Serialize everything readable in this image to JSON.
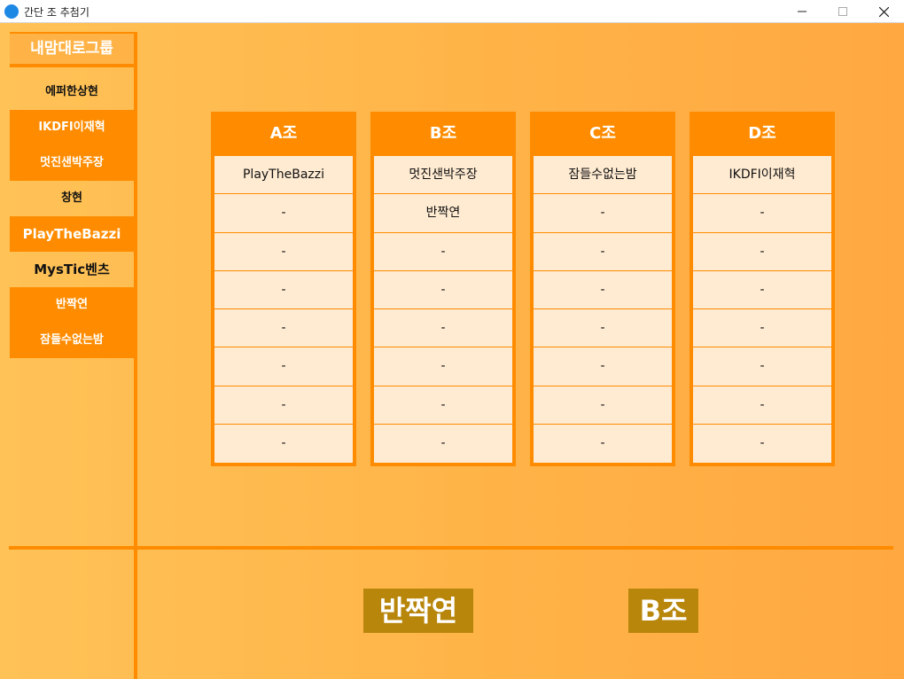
{
  "window": {
    "title": "간단 조 추첨기",
    "app_icon_text": "",
    "minimize_glyph": "—",
    "maximize_glyph": "☐",
    "close_glyph": "✕"
  },
  "sidebar": {
    "group_title": "내맘대로그룹",
    "members": [
      {
        "label": "에퍼한상현",
        "highlighted": false
      },
      {
        "label": "IKDFI이재혁",
        "highlighted": true
      },
      {
        "label": "멋진샌박주장",
        "highlighted": true
      },
      {
        "label": "창현",
        "highlighted": false
      },
      {
        "label": "PlayTheBazzi",
        "highlighted": true
      },
      {
        "label": "MysTic벤츠",
        "highlighted": false
      },
      {
        "label": "반짝연",
        "highlighted": true
      },
      {
        "label": "잠들수없는밤",
        "highlighted": true
      }
    ]
  },
  "teams": [
    {
      "name": "A조",
      "slots": [
        "PlayTheBazzi",
        "-",
        "-",
        "-",
        "-",
        "-",
        "-",
        "-"
      ]
    },
    {
      "name": "B조",
      "slots": [
        "멋진샌박주장",
        "반짝연",
        "-",
        "-",
        "-",
        "-",
        "-",
        "-"
      ]
    },
    {
      "name": "C조",
      "slots": [
        "잠들수없는밤",
        "-",
        "-",
        "-",
        "-",
        "-",
        "-",
        "-"
      ]
    },
    {
      "name": "D조",
      "slots": [
        "IKDFI이재혁",
        "-",
        "-",
        "-",
        "-",
        "-",
        "-",
        "-"
      ]
    }
  ],
  "result": {
    "member": "반짝연",
    "team": "B조"
  },
  "colors": {
    "accent": "#ff8c00",
    "cell_bg": "#ffebd2",
    "result_bg": "#b8860b"
  }
}
